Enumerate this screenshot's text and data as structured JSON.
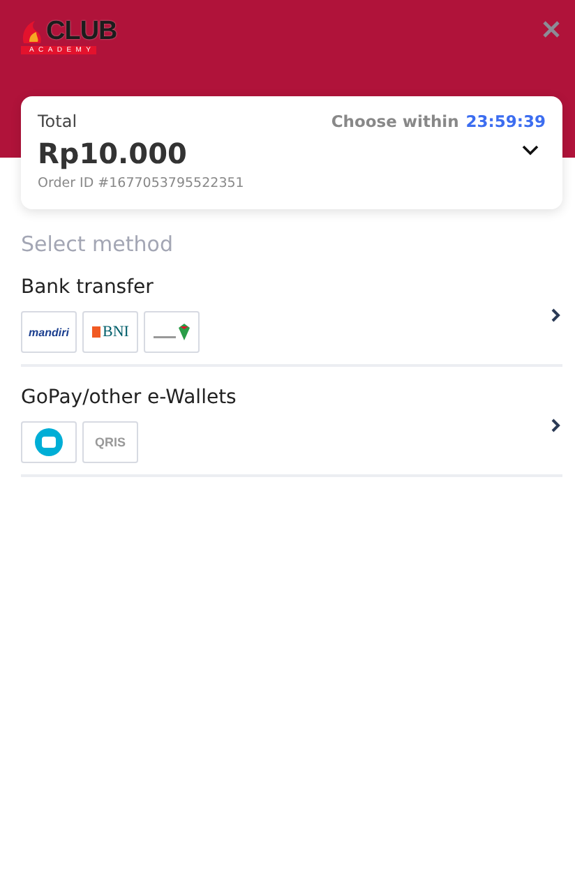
{
  "header": {
    "logo": {
      "word": "CLUB",
      "subtitle": "ACADEMY"
    }
  },
  "summary": {
    "total_label": "Total",
    "amount": "Rp10.000",
    "order_id": "Order ID #1677053795522351",
    "countdown_label": "Choose within",
    "countdown": "23:59:39",
    "expanded": false
  },
  "section_title": "Select method",
  "methods": [
    {
      "name": "Bank transfer",
      "logos": [
        {
          "kind": "mandiri",
          "text": "mandiri"
        },
        {
          "kind": "bni",
          "text": "BNI"
        },
        {
          "kind": "permata"
        }
      ]
    },
    {
      "name": "GoPay/other e-Wallets",
      "logos": [
        {
          "kind": "gopay"
        },
        {
          "kind": "qris",
          "text": "QRIS"
        }
      ]
    }
  ]
}
